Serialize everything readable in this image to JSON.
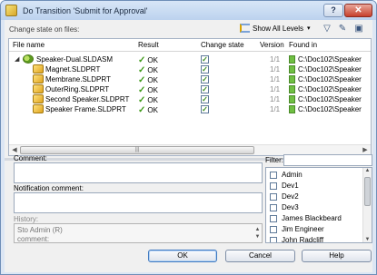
{
  "window": {
    "title": "Do Transition 'Submit for Approval'",
    "help_label": "?",
    "close_label": "✕"
  },
  "toolbar": {
    "change_state_label": "Change state on files:",
    "levels_label": "Show All Levels",
    "levels_caret": "▾"
  },
  "grid": {
    "columns": [
      "File name",
      "Result",
      "Change state",
      "Version",
      "Found in"
    ],
    "rows": [
      {
        "name": "Speaker-Dual.SLDASM",
        "result": "OK",
        "checked": true,
        "version": "1/1",
        "found_in": "C:\\Doc102\\Speaker",
        "level": 0,
        "kind": "assembly"
      },
      {
        "name": "Magnet.SLDPRT",
        "result": "OK",
        "checked": true,
        "version": "1/1",
        "found_in": "C:\\Doc102\\Speaker",
        "level": 1,
        "kind": "part"
      },
      {
        "name": "Membrane.SLDPRT",
        "result": "OK",
        "checked": true,
        "version": "1/1",
        "found_in": "C:\\Doc102\\Speaker",
        "level": 1,
        "kind": "part"
      },
      {
        "name": "OuterRing.SLDPRT",
        "result": "OK",
        "checked": true,
        "version": "1/1",
        "found_in": "C:\\Doc102\\Speaker",
        "level": 1,
        "kind": "part"
      },
      {
        "name": "Second Speaker.SLDPRT",
        "result": "OK",
        "checked": true,
        "version": "1/1",
        "found_in": "C:\\Doc102\\Speaker",
        "level": 1,
        "kind": "part"
      },
      {
        "name": "Speaker Frame.SLDPRT",
        "result": "OK",
        "checked": true,
        "version": "1/1",
        "found_in": "C:\\Doc102\\Speaker",
        "level": 1,
        "kind": "part"
      }
    ]
  },
  "comment": {
    "label": "Comment:",
    "value": ""
  },
  "notification": {
    "label": "Notification comment:",
    "value": ""
  },
  "history": {
    "label": "History:",
    "line1": "Sto Admin (R)",
    "line2": "comment:"
  },
  "filter": {
    "label": "Filter:",
    "value": ""
  },
  "users": [
    "Admin",
    "Dev1",
    "Dev2",
    "Dev3",
    "James Blackbeard",
    "Jim Engineer",
    "John Radcliff"
  ],
  "buttons": {
    "ok": "OK",
    "cancel": "Cancel",
    "help": "Help"
  }
}
